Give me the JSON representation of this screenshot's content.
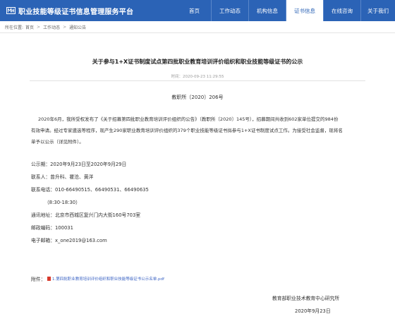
{
  "header": {
    "site_title": "职业技能等级证书信息管理服务平台",
    "nav": [
      "首页",
      "工作动态",
      "机构信息",
      "证书信息",
      "在线咨询",
      "关于我们"
    ],
    "active_index": 3
  },
  "breadcrumb": {
    "prefix": "所在位置:",
    "items": [
      "首页",
      "工作动态",
      "通知公告"
    ]
  },
  "article": {
    "title": "关于参与1+X证书制度试点第四批职业教育培训评价组织和职业技能等级证书的公示",
    "date": "时间：2020-09-23 11:29:55",
    "doc_no": "教职所〔2020〕206号",
    "body_lines": [
      "2020年6月，我所受权发布了《关于招募第四批职业教育培训评价组织的公告》（教职所〔2020〕145号），招募期间共收到602家单位提交的984份",
      "有效申请。经过专家遴选等程序，现产生290家职业教育培训评价组织的379个职业技能等级证书拟参与1+X证书制度试点工作。为接受社会监督，现将名",
      "单予以公示（详见附件）。"
    ],
    "info_lines": [
      "公示期：2020年9月23日至2020年9月29日",
      "联系人：曾升科、瞿沧、黄洋",
      "联系电话：010-66490515、66490531、66490635",
      "（8:30-18:30）",
      "通讯地址：北京市西城区复兴门内大街160号703室",
      "邮政编码：100031",
      "电子邮箱：x_one2019@163.com"
    ],
    "attachment_label": "附件：",
    "attachment_link": "1.第四批职业教育培训评价组织和职业技能等级证书公示名单.pdf",
    "org": "教育部职业技术教育中心研究所",
    "sign_date": "2020年9月23日"
  },
  "colors": {
    "header_bg": "#2b63b6",
    "link": "#3b63c4"
  }
}
